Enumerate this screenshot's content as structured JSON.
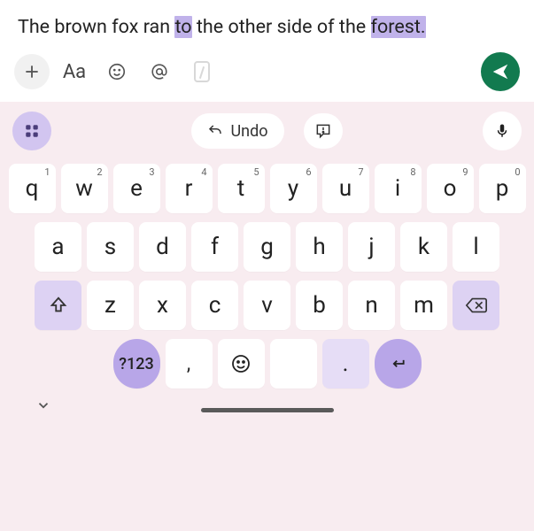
{
  "text": {
    "pre1": "The brown fox ran ",
    "hl1": "to",
    "mid": " the other side of the ",
    "hl2": "forest.",
    "post": ""
  },
  "toolbar": {
    "aa_label": "Aa"
  },
  "kbd_top": {
    "undo_label": "Undo"
  },
  "rows": {
    "r1": [
      {
        "main": "q",
        "sup": "1"
      },
      {
        "main": "w",
        "sup": "2"
      },
      {
        "main": "e",
        "sup": "3"
      },
      {
        "main": "r",
        "sup": "4"
      },
      {
        "main": "t",
        "sup": "5"
      },
      {
        "main": "y",
        "sup": "6"
      },
      {
        "main": "u",
        "sup": "7"
      },
      {
        "main": "i",
        "sup": "8"
      },
      {
        "main": "o",
        "sup": "9"
      },
      {
        "main": "p",
        "sup": "0"
      }
    ],
    "r2": [
      {
        "main": "a"
      },
      {
        "main": "s"
      },
      {
        "main": "d"
      },
      {
        "main": "f"
      },
      {
        "main": "g"
      },
      {
        "main": "h"
      },
      {
        "main": "j"
      },
      {
        "main": "k"
      },
      {
        "main": "l"
      }
    ],
    "r3": [
      {
        "main": "z"
      },
      {
        "main": "x"
      },
      {
        "main": "c"
      },
      {
        "main": "v"
      },
      {
        "main": "b"
      },
      {
        "main": "n"
      },
      {
        "main": "m"
      }
    ],
    "r4": {
      "sym": "?123",
      "comma": ",",
      "period": "."
    }
  }
}
